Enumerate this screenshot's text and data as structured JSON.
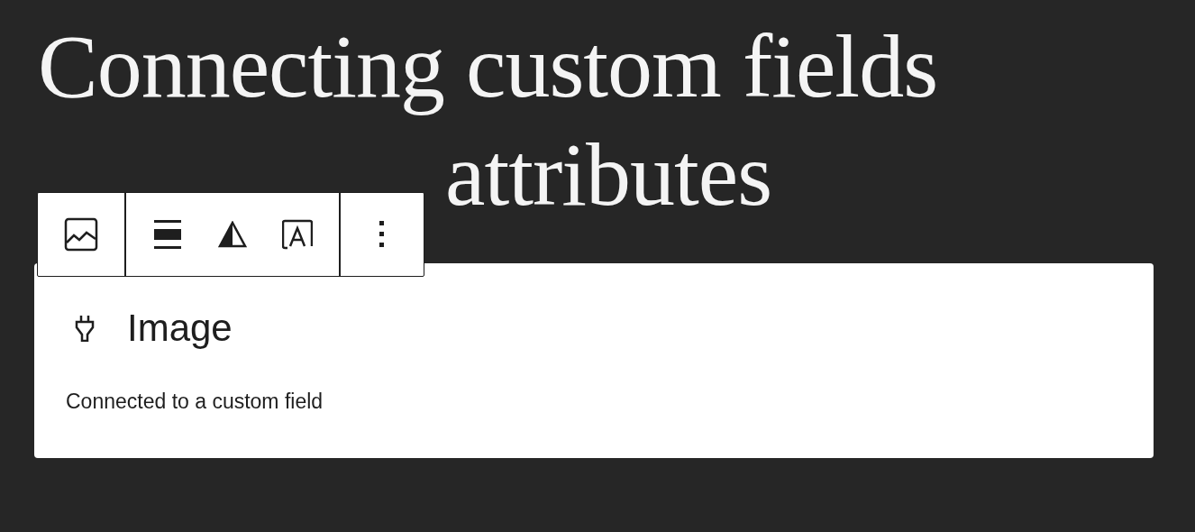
{
  "heading": {
    "lines": [
      "Connecting custom fields",
      "attributes"
    ]
  },
  "placeholder": {
    "title": "Image",
    "note": "Connected to a custom field"
  }
}
